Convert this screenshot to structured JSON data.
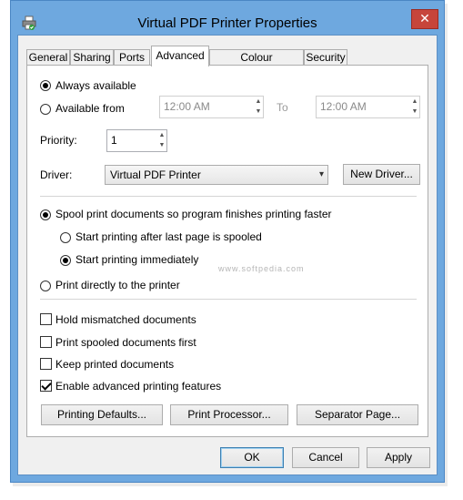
{
  "window": {
    "title": "Virtual PDF Printer Properties",
    "close_glyph": "✕",
    "icon": "printer-icon"
  },
  "tabs": [
    "General",
    "Sharing",
    "Ports",
    "Advanced",
    "Colour Management",
    "Security"
  ],
  "availability": {
    "always_label": "Always available",
    "from_label": "Available from",
    "from_time": "12:00 AM",
    "to_label": "To",
    "to_time": "12:00 AM"
  },
  "priority": {
    "label": "Priority:",
    "value": "1"
  },
  "driver": {
    "label": "Driver:",
    "value": "Virtual PDF Printer",
    "new_button": "New Driver..."
  },
  "spool": {
    "spool_label": "Spool print documents so program finishes printing faster",
    "after_last_label": "Start printing after last page is spooled",
    "immediately_label": "Start printing immediately",
    "direct_label": "Print directly to the printer"
  },
  "options": {
    "hold_mismatched": "Hold mismatched documents",
    "spooled_first": "Print spooled documents first",
    "keep_printed": "Keep printed documents",
    "enable_advanced": "Enable advanced printing features"
  },
  "buttons": {
    "printing_defaults": "Printing Defaults...",
    "print_processor": "Print Processor...",
    "separator_page": "Separator Page...",
    "ok": "OK",
    "cancel": "Cancel",
    "apply": "Apply"
  },
  "watermark": "www.softpedia.com",
  "colors": {
    "titlebar": "#6ea8df",
    "close": "#c7453b",
    "default_button_border": "#3c7fb1"
  }
}
